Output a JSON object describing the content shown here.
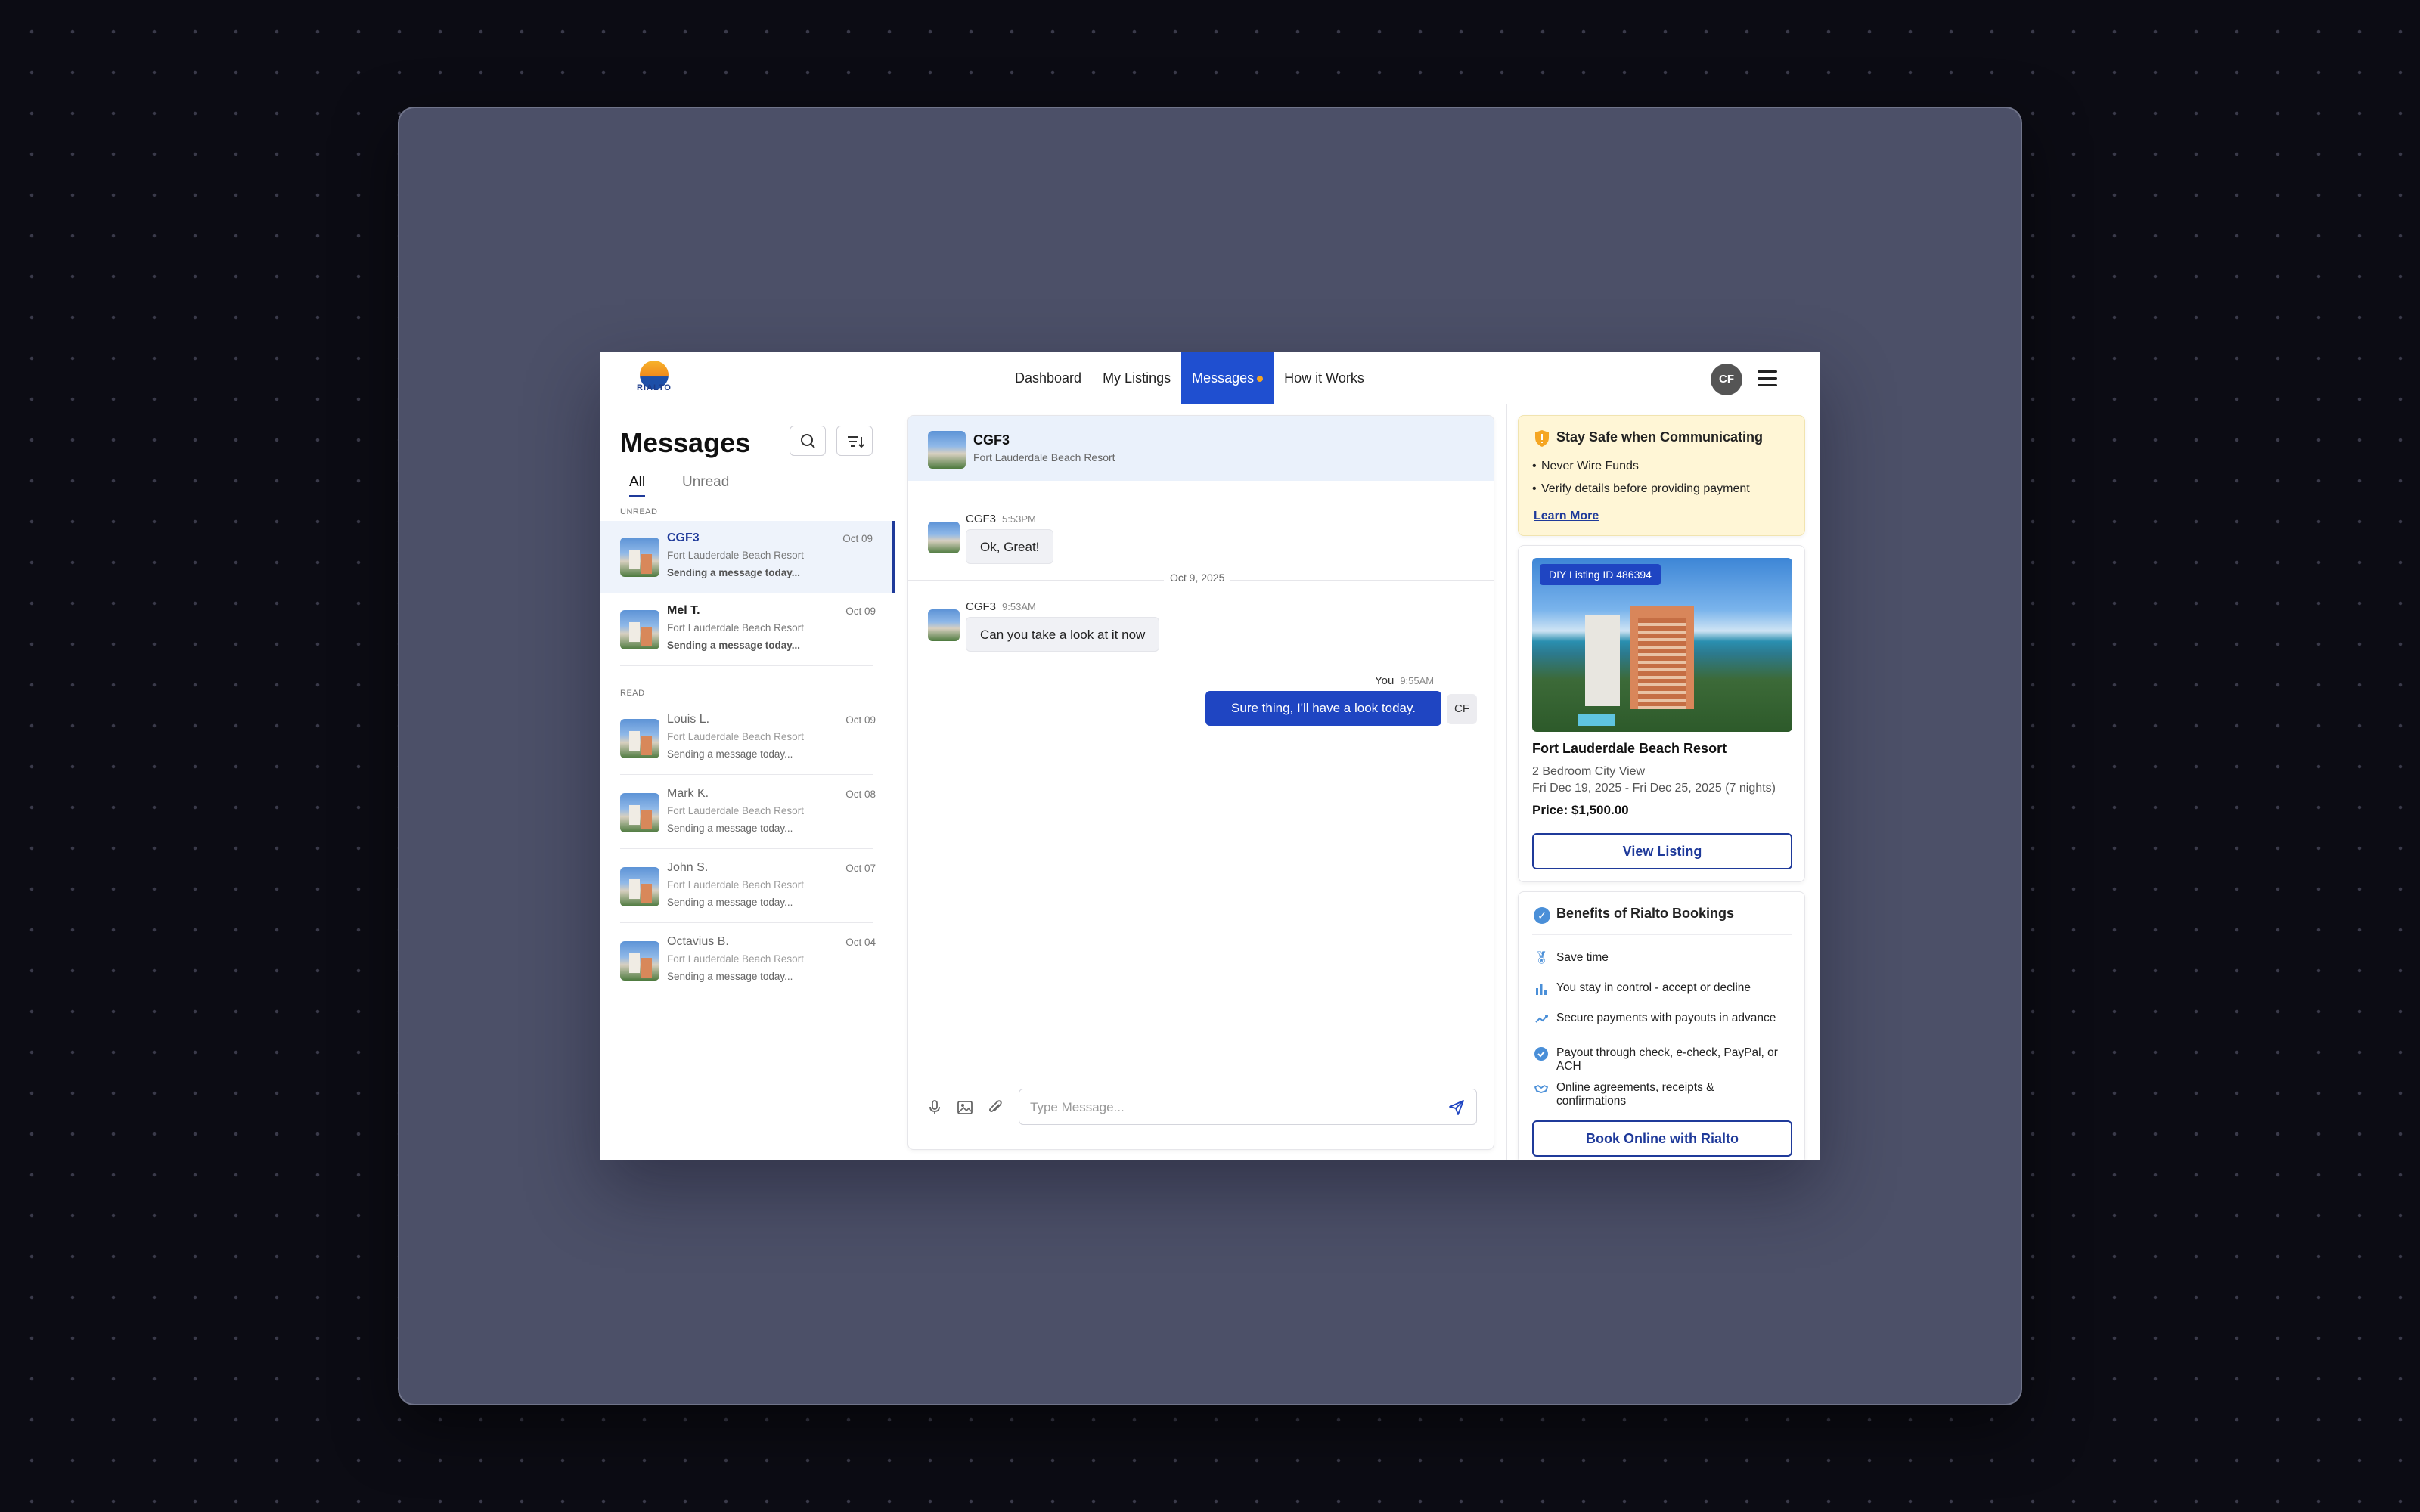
{
  "brand": {
    "logo_text": "RIALTO"
  },
  "nav": {
    "links": [
      "Dashboard",
      "My Listings",
      "Messages",
      "How it Works"
    ],
    "active": "Messages",
    "avatar_initials": "CF"
  },
  "inbox": {
    "title": "Messages",
    "tabs": [
      "All",
      "Unread"
    ],
    "active_tab": "All",
    "unread_label": "UNREAD",
    "read_label": "READ",
    "unread": [
      {
        "name": "CGF3",
        "resort": "Fort Lauderdale Beach Resort",
        "snippet": "Sending a message today...",
        "date": "Oct 09",
        "selected": true
      },
      {
        "name": "Mel T.",
        "resort": "Fort Lauderdale Beach Resort",
        "snippet": "Sending a message today...",
        "date": "Oct 09"
      }
    ],
    "read": [
      {
        "name": "Louis L.",
        "resort": "Fort Lauderdale Beach Resort",
        "snippet": "Sending a message today...",
        "date": "Oct 09"
      },
      {
        "name": "Mark K.",
        "resort": "Fort Lauderdale Beach Resort",
        "snippet": "Sending a message today...",
        "date": "Oct 08"
      },
      {
        "name": "John S.",
        "resort": "Fort Lauderdale Beach Resort",
        "snippet": "Sending a message today...",
        "date": "Oct 07"
      },
      {
        "name": "Octavius B.",
        "resort": "Fort Lauderdale Beach Resort",
        "snippet": "Sending a message today...",
        "date": "Oct 04"
      }
    ]
  },
  "chat": {
    "header": {
      "name": "CGF3",
      "resort": "Fort Lauderdale Beach Resort"
    },
    "messages": [
      {
        "sender": "CGF3",
        "time": "5:53PM",
        "text": "Ok, Great!"
      },
      {
        "sender": "CGF3",
        "time": "9:53AM",
        "text": "Can you take a look at it now"
      },
      {
        "sender": "You",
        "time": "9:55AM",
        "text": "Sure thing, I'll have a look today.",
        "badge": "CF"
      }
    ],
    "day_divider": "Oct 9, 2025",
    "composer_placeholder": "Type Message..."
  },
  "safety": {
    "title": "Stay Safe when Communicating",
    "bullets": [
      "Never Wire Funds",
      "Verify details before providing payment"
    ],
    "link": "Learn More"
  },
  "listing": {
    "badge": "DIY Listing ID 486394",
    "name": "Fort Lauderdale Beach Resort",
    "room": "2 Bedroom City View",
    "dates": "Fri Dec 19, 2025 - Fri Dec 25, 2025 (7 nights)",
    "price": "Price: $1,500.00",
    "button": "View Listing"
  },
  "benefits": {
    "title": "Benefits of Rialto Bookings",
    "items": [
      {
        "icon": "medal-icon",
        "text": "Save time"
      },
      {
        "icon": "chart-icon",
        "text": "You stay in control - accept or decline"
      },
      {
        "icon": "secure-icon",
        "text": "Secure payments with payouts in advance"
      },
      {
        "icon": "check-icon",
        "text": "Payout through check, e-check, PayPal, or ACH"
      },
      {
        "icon": "handshake-icon",
        "text": "Online agreements, receipts & confirmations"
      }
    ],
    "button": "Book Online with Rialto"
  },
  "colors": {
    "accent": "#1f45c2",
    "nav_active": "#1f4fd0",
    "notification_dot": "#f5a623",
    "safety_bg": "#fff6d6",
    "frame_bg": "#4c5068"
  }
}
